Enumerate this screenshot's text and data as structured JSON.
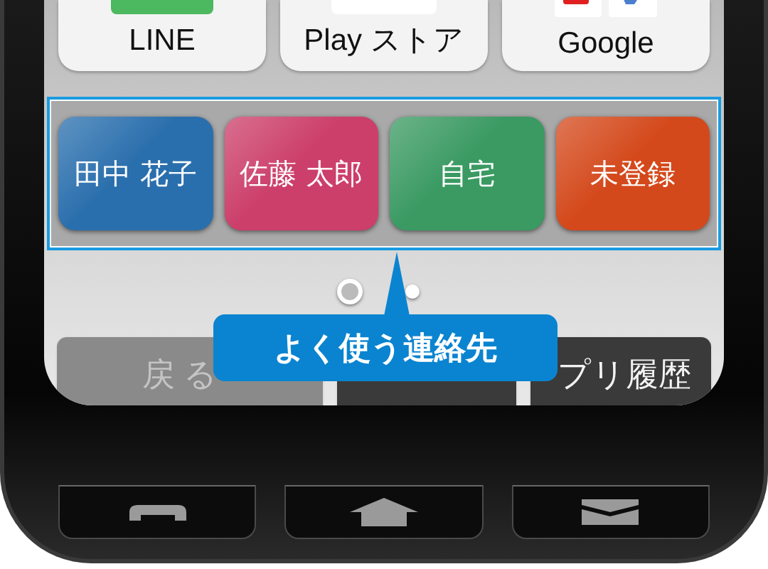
{
  "apps": [
    {
      "label": "LINE",
      "kind": "line"
    },
    {
      "label": "Play ストア",
      "kind": "play"
    },
    {
      "label": "Google",
      "kind": "google"
    }
  ],
  "favorites": [
    {
      "name": "田中 花子",
      "color": "#2a6fad"
    },
    {
      "name": "佐藤 太郎",
      "color": "#cc3f6a"
    },
    {
      "name": "自宅",
      "color": "#3a9a62"
    },
    {
      "name": "未登録",
      "color": "#d4491c"
    }
  ],
  "pages": [
    {
      "selected": true
    },
    {
      "selected": false
    }
  ],
  "nav": [
    {
      "label": "戻る",
      "disabled": true
    },
    {
      "disabled": false
    },
    {
      "label": "プリ履歴",
      "disabled": false
    }
  ],
  "callout": {
    "text": "よく使う連絡先"
  },
  "keys": [
    {
      "kind": "call"
    },
    {
      "kind": "home"
    },
    {
      "kind": "mail"
    }
  ]
}
